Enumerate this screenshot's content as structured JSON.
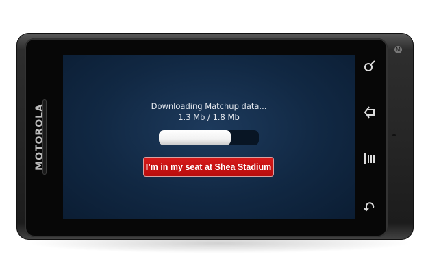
{
  "device": {
    "brand": "MOTOROLA",
    "logo_icon": "motorola-logo-icon"
  },
  "status": {
    "line1": "Downloading Matchup data...",
    "line2": "1.3 Mb / 1.8 Mb"
  },
  "progress": {
    "downloaded_mb": 1.3,
    "total_mb": 1.8,
    "percent": 72
  },
  "action_button": {
    "label": "I’m in my seat at Shea Stadium",
    "color": "#c8101a"
  },
  "nav_buttons": [
    {
      "name": "search-icon",
      "glyph": "⚲"
    },
    {
      "name": "home-icon",
      "glyph": "⌂"
    },
    {
      "name": "menu-icon",
      "glyph": "|||"
    },
    {
      "name": "back-icon",
      "glyph": "↶"
    }
  ]
}
